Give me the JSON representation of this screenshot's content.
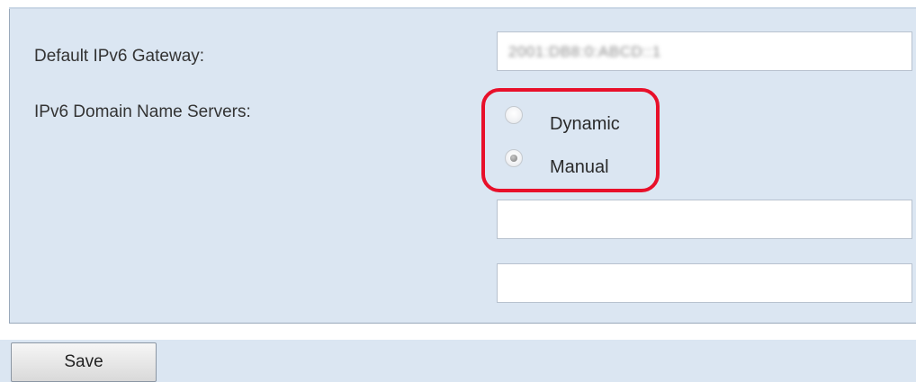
{
  "form": {
    "gateway_label": "Default IPv6 Gateway:",
    "gateway_value": "2001:DB8:0:ABCD::1",
    "dns_label": "IPv6 Domain Name Servers:",
    "dns_options": [
      {
        "label": "Dynamic",
        "selected": false
      },
      {
        "label": "Manual",
        "selected": true
      }
    ],
    "dns_primary_value": "",
    "dns_secondary_value": ""
  },
  "actions": {
    "save_label": "Save"
  },
  "colors": {
    "panel_bg": "#dbe6f2",
    "highlight": "#e8102a"
  }
}
